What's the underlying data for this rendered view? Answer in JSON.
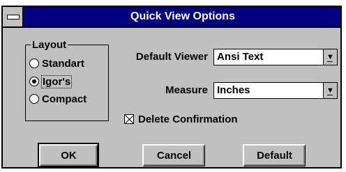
{
  "window": {
    "title": "Quick View Options"
  },
  "layout_group": {
    "label": "Layout",
    "options": [
      {
        "label": "Standart",
        "selected": false
      },
      {
        "label": "Igor's",
        "selected": true
      },
      {
        "label": "Compact",
        "selected": false
      }
    ]
  },
  "default_viewer": {
    "label": "Default Viewer",
    "value": "Ansi Text"
  },
  "measure": {
    "label": "Measure",
    "value": "Inches"
  },
  "delete_confirmation": {
    "label": "Delete Confirmation",
    "checked": true
  },
  "buttons": {
    "ok": "OK",
    "cancel": "Cancel",
    "default": "Default"
  },
  "colors": {
    "titlebar": "#000080",
    "face": "#c0c0c0"
  }
}
